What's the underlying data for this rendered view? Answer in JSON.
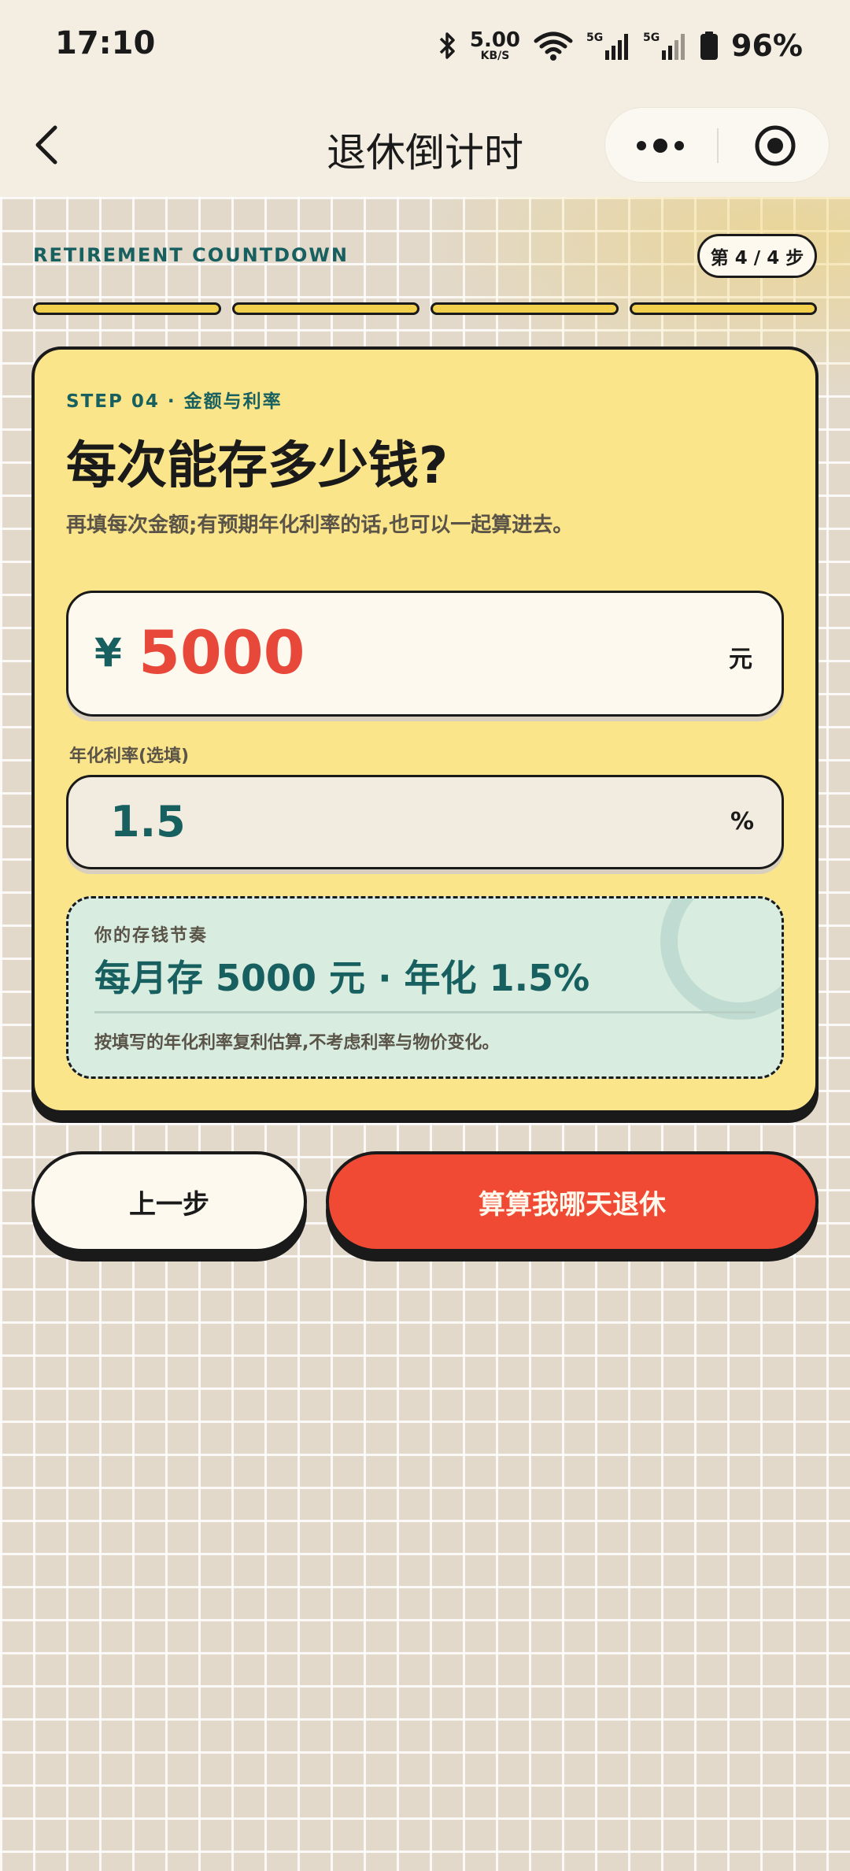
{
  "status_bar": {
    "time": "17:10",
    "net_speed_value": "5.00",
    "net_speed_unit": "KB/S",
    "battery": "96%",
    "icons": [
      "bluetooth-icon",
      "wifi-icon",
      "signal-5g-icon",
      "signal-5g-icon",
      "battery-icon"
    ]
  },
  "nav": {
    "title": "退休倒计时"
  },
  "header": {
    "brand": "RETIREMENT COUNTDOWN",
    "step_indicator": "第 4 / 4 步",
    "progress_steps": 4,
    "progress_completed": 4
  },
  "card": {
    "step_label": "STEP 04 · 金额与利率",
    "heading": "每次能存多少钱?",
    "subtext": "再填每次金额;有预期年化利率的话,也可以一起算进去。",
    "amount": {
      "currency": "¥",
      "value": "5000",
      "unit": "元"
    },
    "rate": {
      "label": "年化利率(选填)",
      "value": "1.5",
      "unit": "%"
    },
    "summary": {
      "label": "你的存钱节奏",
      "value": "每月存 5000 元 · 年化 1.5%",
      "note": "按填写的年化利率复利估算,不考虑利率与物价变化。"
    }
  },
  "actions": {
    "prev_label": "上一步",
    "calc_label": "算算我哪天退休"
  },
  "colors": {
    "card_bg": "#fbe58a",
    "accent_teal": "#17605f",
    "accent_red": "#f04a35",
    "amount_red": "#e8483a",
    "progress_yellow": "#f3cf4e",
    "summary_bg": "#d8ece0"
  }
}
